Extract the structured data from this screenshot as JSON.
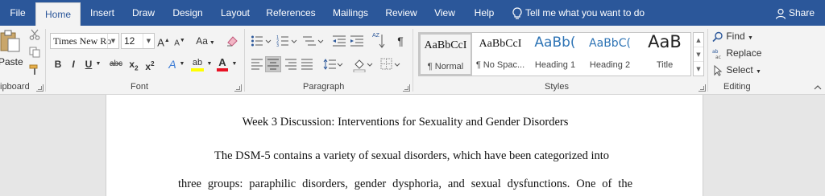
{
  "tabs": [
    {
      "label": "File",
      "active": false
    },
    {
      "label": "Home",
      "active": true
    },
    {
      "label": "Insert",
      "active": false
    },
    {
      "label": "Draw",
      "active": false
    },
    {
      "label": "Design",
      "active": false
    },
    {
      "label": "Layout",
      "active": false
    },
    {
      "label": "References",
      "active": false
    },
    {
      "label": "Mailings",
      "active": false
    },
    {
      "label": "Review",
      "active": false
    },
    {
      "label": "View",
      "active": false
    },
    {
      "label": "Help",
      "active": false
    }
  ],
  "tell_me": "Tell me what you want to do",
  "share": "Share",
  "clipboard": {
    "label": "ipboard",
    "paste": "Paste"
  },
  "font": {
    "label": "Font",
    "name": "Times New Ro",
    "size": "12",
    "grow": "A",
    "shrink": "A",
    "change_case": "Aa",
    "bold": "B",
    "italic": "I",
    "underline": "U",
    "strike": "abc",
    "subscript": "x",
    "subscript_2": "2",
    "superscript": "x",
    "superscript_2": "2",
    "text_effects": "A",
    "highlight": "ab",
    "font_color": "A"
  },
  "paragraph": {
    "label": "Paragraph",
    "sort": "AZ",
    "pilcrow": "¶"
  },
  "styles": {
    "label": "Styles",
    "items": [
      {
        "preview": "AaBbCcI",
        "name": "¶ Normal",
        "selected": true
      },
      {
        "preview": "AaBbCcI",
        "name": "¶ No Spac...",
        "selected": false
      },
      {
        "preview": "AaBb(",
        "name": "Heading 1",
        "selected": false
      },
      {
        "preview": "AaBbC(",
        "name": "Heading 2",
        "selected": false
      },
      {
        "preview": "AaB",
        "name": "Title",
        "selected": false
      }
    ]
  },
  "editing": {
    "label": "Editing",
    "find": "Find",
    "replace": "Replace",
    "select": "Select"
  },
  "document": {
    "title": "Week 3 Discussion: Interventions for Sexuality and Gender Disorders",
    "line1": "The DSM-5 contains a variety of sexual disorders, which have been categorized into",
    "line2": "three groups: paraphilic disorders, gender dysphoria, and sexual dysfunctions. One of the"
  },
  "colors": {
    "tab_bar": "#2b579a",
    "ribbon": "#f3f3f3",
    "highlight_swatch": "#ffff00",
    "font_color_swatch": "#e81123",
    "heading_blue": "#2e74b5"
  }
}
